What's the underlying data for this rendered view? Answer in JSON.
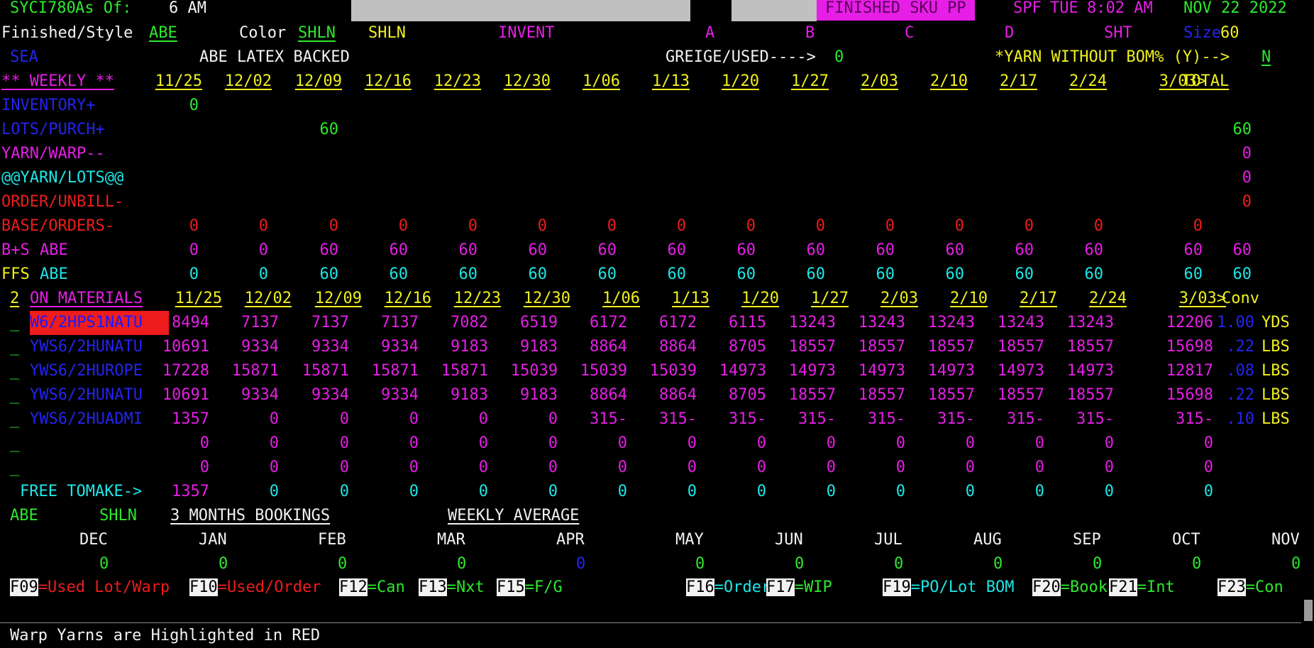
{
  "header": {
    "program": "SYCI780",
    "as_of_label": "As Of:",
    "as_of_value": "6 AM",
    "screen_name": "FINISHED SKU PP",
    "system": "SPF",
    "day": "TUE",
    "time": "8:02 AM",
    "date": "NOV 22 2022"
  },
  "row2": {
    "style_label": "Finished/Style",
    "style_value": "ABE",
    "color_label": "Color",
    "color_value": "SHLN",
    "color_desc": "SHLN",
    "invent": "INVENT",
    "a": "A",
    "b": "B",
    "c": "C",
    "d": "D",
    "sht": "SHT",
    "size_label": "Size",
    "size_value": "60"
  },
  "row3": {
    "sea": "SEA",
    "desc": "ABE LATEX BACKED",
    "greige_label": "GREIGE/USED---->",
    "greige_value": "0",
    "yarn_label": "*YARN WITHOUT BOM% (Y)-->",
    "yarn_value": "N"
  },
  "weekly": {
    "label": "** WEEKLY **",
    "dates": [
      "11/25",
      "12/02",
      "12/09",
      "12/16",
      "12/23",
      "12/30",
      "1/06",
      "1/13",
      "1/20",
      "1/27",
      "2/03",
      "2/10",
      "2/17",
      "2/24",
      "3/03>"
    ],
    "total_label": "TOTAL"
  },
  "rows": [
    {
      "label": "INVENTORY+",
      "cells": [
        "0",
        "",
        "",
        "",
        "",
        "",
        "",
        "",
        "",
        "",
        "",
        "",
        "",
        "",
        ""
      ],
      "total": ""
    },
    {
      "label": "LOTS/PURCH+",
      "cells": [
        "",
        "",
        "60",
        "",
        "",
        "",
        "",
        "",
        "",
        "",
        "",
        "",
        "",
        "",
        ""
      ],
      "total": "60"
    },
    {
      "label": "YARN/WARP--",
      "cells": [
        "",
        "",
        "",
        "",
        "",
        "",
        "",
        "",
        "",
        "",
        "",
        "",
        "",
        "",
        ""
      ],
      "total": "0"
    },
    {
      "label": "@@YARN/LOTS@@",
      "cells": [
        "",
        "",
        "",
        "",
        "",
        "",
        "",
        "",
        "",
        "",
        "",
        "",
        "",
        "",
        ""
      ],
      "total": "0"
    },
    {
      "label": "ORDER/UNBILL-",
      "cells": [
        "",
        "",
        "",
        "",
        "",
        "",
        "",
        "",
        "",
        "",
        "",
        "",
        "",
        "",
        ""
      ],
      "total": "0"
    },
    {
      "label": "BASE/ORDERS-",
      "cells": [
        "0",
        "0",
        "0",
        "0",
        "0",
        "0",
        "0",
        "0",
        "0",
        "0",
        "0",
        "0",
        "0",
        "0",
        "0"
      ],
      "total": ""
    },
    {
      "label": "B+S",
      "label2": "ABE",
      "cells": [
        "0",
        "0",
        "60",
        "60",
        "60",
        "60",
        "60",
        "60",
        "60",
        "60",
        "60",
        "60",
        "60",
        "60",
        "60"
      ],
      "total": "60"
    },
    {
      "label": "FFS",
      "label2": "ABE",
      "cells": [
        "0",
        "0",
        "60",
        "60",
        "60",
        "60",
        "60",
        "60",
        "60",
        "60",
        "60",
        "60",
        "60",
        "60",
        "60"
      ],
      "total": "60"
    }
  ],
  "materials": {
    "count": "2",
    "label": "ON MATERIALS",
    "dates": [
      "11/25",
      "12/02",
      "12/09",
      "12/16",
      "12/23",
      "12/30",
      "1/06",
      "1/13",
      "1/20",
      "1/27",
      "2/03",
      "2/10",
      "2/17",
      "2/24",
      "3/03>"
    ],
    "conv_label": "Conv",
    "items": [
      {
        "sel": "_",
        "name": "W6/2HPS1NATU",
        "highlight": true,
        "cells": [
          "8494",
          "7137",
          "7137",
          "7137",
          "7082",
          "6519",
          "6172",
          "6172",
          "6115",
          "13243",
          "13243",
          "13243",
          "13243",
          "13243",
          "12206"
        ],
        "conv": "1.00",
        "unit": "YDS"
      },
      {
        "sel": "_",
        "name": "YWS6/2HUNATU",
        "highlight": false,
        "cells": [
          "10691",
          "9334",
          "9334",
          "9334",
          "9183",
          "9183",
          "8864",
          "8864",
          "8705",
          "18557",
          "18557",
          "18557",
          "18557",
          "18557",
          "15698"
        ],
        "conv": ".22",
        "unit": "LBS"
      },
      {
        "sel": "_",
        "name": "YWS6/2HUROPE",
        "highlight": false,
        "cells": [
          "17228",
          "15871",
          "15871",
          "15871",
          "15871",
          "15039",
          "15039",
          "15039",
          "14973",
          "14973",
          "14973",
          "14973",
          "14973",
          "14973",
          "12817"
        ],
        "conv": ".08",
        "unit": "LBS"
      },
      {
        "sel": "_",
        "name": "YWS6/2HUNATU",
        "highlight": false,
        "cells": [
          "10691",
          "9334",
          "9334",
          "9334",
          "9183",
          "9183",
          "8864",
          "8864",
          "8705",
          "18557",
          "18557",
          "18557",
          "18557",
          "18557",
          "15698"
        ],
        "conv": ".22",
        "unit": "LBS"
      },
      {
        "sel": "_",
        "name": "YWS6/2HUADMI",
        "highlight": false,
        "cells": [
          "1357",
          "0",
          "0",
          "0",
          "0",
          "0",
          "315-",
          "315-",
          "315-",
          "315-",
          "315-",
          "315-",
          "315-",
          "315-",
          "315-"
        ],
        "conv": ".10",
        "unit": "LBS"
      },
      {
        "sel": "_",
        "name": "",
        "highlight": false,
        "cells": [
          "0",
          "0",
          "0",
          "0",
          "0",
          "0",
          "0",
          "0",
          "0",
          "0",
          "0",
          "0",
          "0",
          "0",
          "0"
        ],
        "conv": "",
        "unit": ""
      },
      {
        "sel": "_",
        "name": "",
        "highlight": false,
        "cells": [
          "0",
          "0",
          "0",
          "0",
          "0",
          "0",
          "0",
          "0",
          "0",
          "0",
          "0",
          "0",
          "0",
          "0",
          "0"
        ],
        "conv": "",
        "unit": ""
      }
    ],
    "free_label": "FREE TOMAKE->",
    "free_cells": [
      "1357",
      "0",
      "0",
      "0",
      "0",
      "0",
      "0",
      "0",
      "0",
      "0",
      "0",
      "0",
      "0",
      "0",
      "0"
    ]
  },
  "bookings": {
    "style": "ABE",
    "color": "SHLN",
    "label": "3 MONTHS BOOKINGS",
    "avg_label": "WEEKLY AVERAGE",
    "months": [
      "DEC",
      "JAN",
      "FEB",
      "MAR",
      "APR",
      "MAY",
      "JUN",
      "JUL",
      "AUG",
      "SEP",
      "OCT",
      "NOV"
    ],
    "values": [
      "0",
      "0",
      "0",
      "0",
      "0",
      "0",
      "0",
      "0",
      "0",
      "0",
      "0",
      "0"
    ]
  },
  "fkeys": [
    {
      "key": "F09",
      "label": "=Used Lot/Warp",
      "color": "#ee1c1c"
    },
    {
      "key": "F10",
      "label": "=Used/Order",
      "color": "#ee1c1c"
    },
    {
      "key": "F12",
      "label": "=Can",
      "color": "#2ee82e"
    },
    {
      "key": "F13",
      "label": "=Nxt",
      "color": "#2ee82e"
    },
    {
      "key": "F15",
      "label": "=F/G",
      "color": "#2ee82e"
    },
    {
      "key": "F16",
      "label": "=Orders",
      "color": "#1ee6e6"
    },
    {
      "key": "F17",
      "label": "=WIP",
      "color": "#2ee82e"
    },
    {
      "key": "F19",
      "label": "=PO/Lot BOM",
      "color": "#1ee6e6"
    },
    {
      "key": "F20",
      "label": "=Book",
      "color": "#2ee82e"
    },
    {
      "key": "F21",
      "label": "=Int",
      "color": "#2ee82e"
    },
    {
      "key": "F23",
      "label": "=Con",
      "color": "#2ee82e"
    }
  ],
  "message": "Warp Yarns are Highlighted in RED"
}
